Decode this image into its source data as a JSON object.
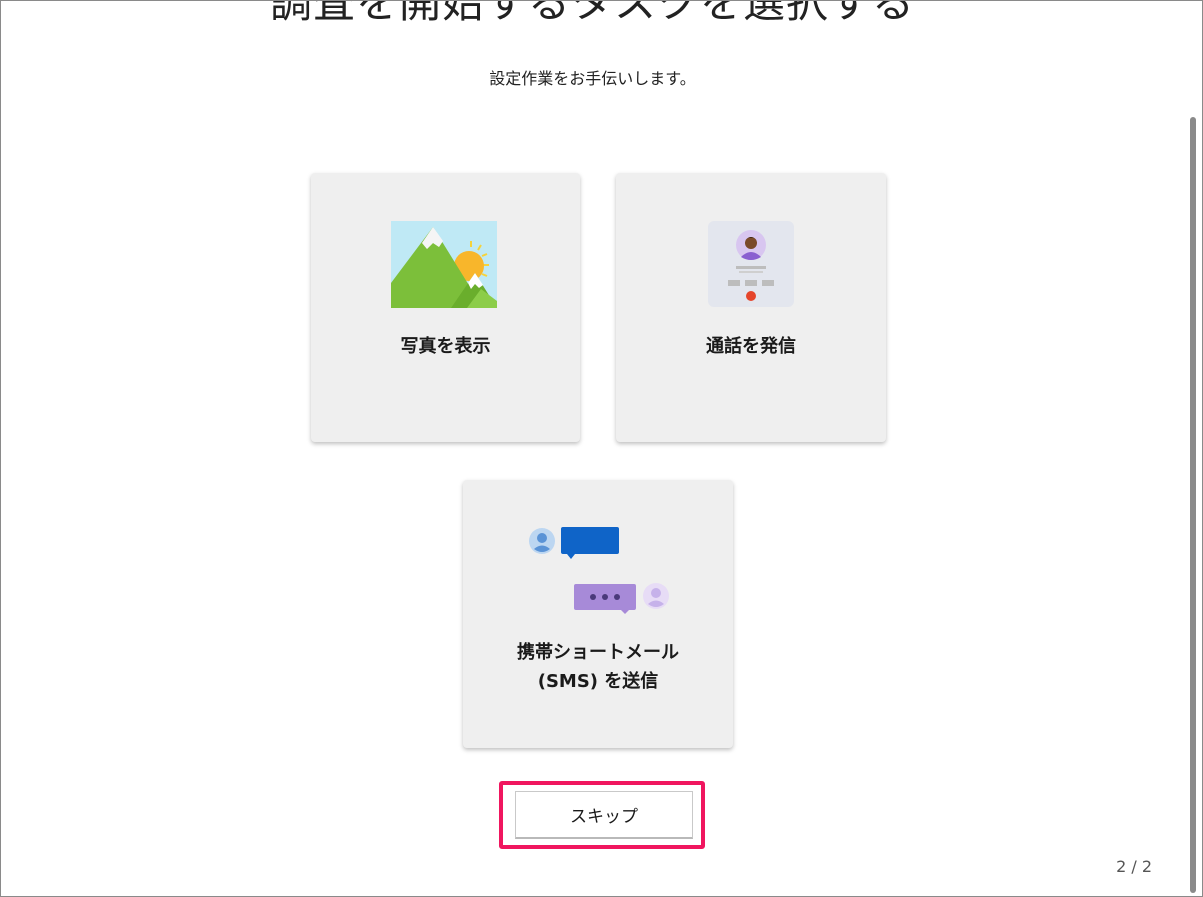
{
  "header": {
    "title": "調査を開始するタスクを選択する",
    "subtitle": "設定作業をお手伝いします。"
  },
  "tasks": [
    {
      "label": "写真を表示",
      "icon": "photo-mountain-icon"
    },
    {
      "label": "通話を発信",
      "icon": "call-contact-icon"
    },
    {
      "label_line1": "携帯ショートメール",
      "label_line2": "(SMS) を送信",
      "icon": "sms-chat-icon"
    }
  ],
  "footer": {
    "skip_label": "スキップ",
    "page_indicator": "2 / 2"
  },
  "colors": {
    "card_bg": "#efefef",
    "highlight": "#f0165f",
    "chat_blue": "#0f64c8",
    "chat_purple": "#a78ad8",
    "call_red": "#e5452b"
  }
}
